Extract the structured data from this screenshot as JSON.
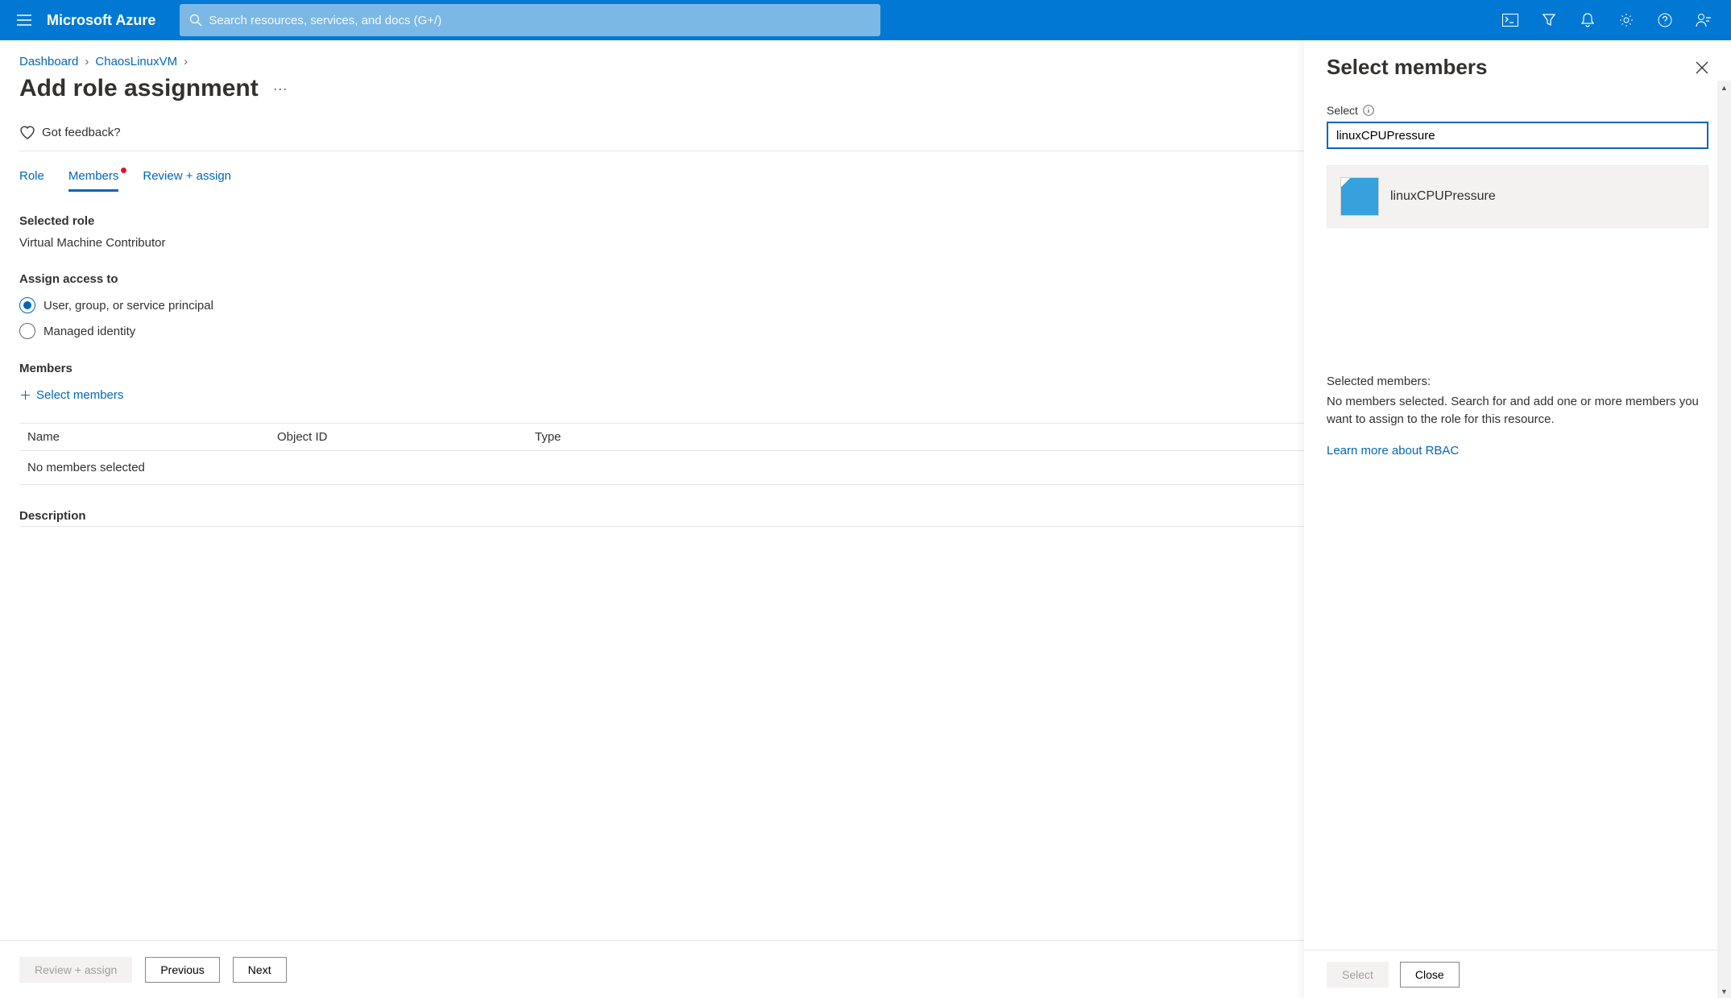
{
  "topbar": {
    "brand": "Microsoft Azure",
    "search_placeholder": "Search resources, services, and docs (G+/)"
  },
  "breadcrumb": {
    "item1": "Dashboard",
    "item2": "ChaosLinuxVM"
  },
  "page": {
    "title": "Add role assignment",
    "feedback": "Got feedback?"
  },
  "tabs": {
    "role": "Role",
    "members": "Members",
    "review": "Review + assign"
  },
  "form": {
    "selected_role_label": "Selected role",
    "selected_role_value": "Virtual Machine Contributor",
    "assign_access_label": "Assign access to",
    "radio_user": "User, group, or service principal",
    "radio_managed": "Managed identity",
    "members_label": "Members",
    "select_members": "Select members",
    "col_name": "Name",
    "col_object": "Object ID",
    "col_type": "Type",
    "no_members": "No members selected",
    "description": "Description"
  },
  "footer": {
    "review": "Review + assign",
    "previous": "Previous",
    "next": "Next"
  },
  "panel": {
    "title": "Select members",
    "select_label": "Select",
    "input_value": "linuxCPUPressure",
    "result_name": "linuxCPUPressure",
    "selected_members_label": "Selected members:",
    "selected_members_msg": "No members selected. Search for and add one or more members you want to assign to the role for this resource.",
    "rbac_link": "Learn more about RBAC",
    "select_btn": "Select",
    "close_btn": "Close"
  }
}
